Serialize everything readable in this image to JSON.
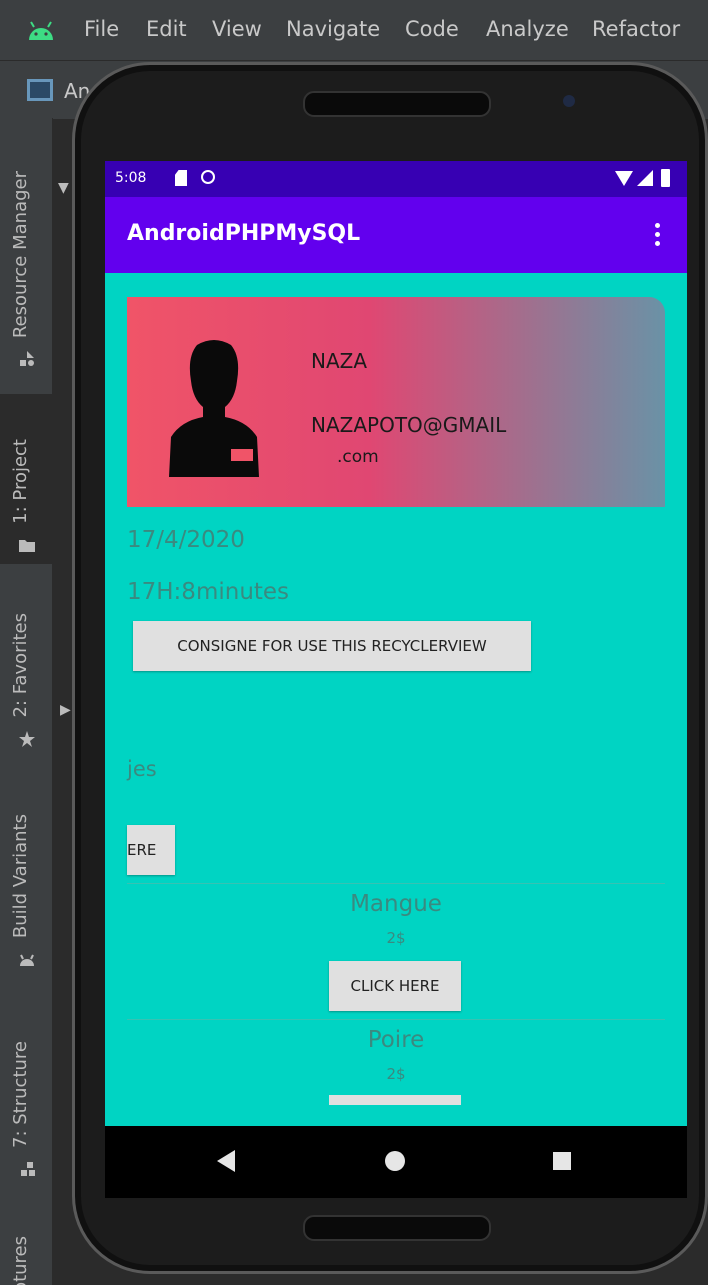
{
  "ide": {
    "menu": [
      "File",
      "Edit",
      "View",
      "Navigate",
      "Code",
      "Analyze",
      "Refactor"
    ],
    "breadcrumb": "And",
    "tool_windows": {
      "resource_manager": "Resource Manager",
      "project": "1: Project",
      "favorites": "2: Favorites",
      "build_variants": "Build Variants",
      "structure": "7: Structure",
      "captures": "ptures"
    }
  },
  "phone": {
    "status_bar": {
      "time": "5:08"
    },
    "app_bar": {
      "title": "AndroidPHPMySQL",
      "overflow_icon": "more-vert-icon"
    },
    "profile": {
      "name": "NAZA",
      "email": "NAZAPOTO@GMAIL",
      "email_suffix": ".com",
      "avatar_icon": "person-icon"
    },
    "date": "17/4/2020",
    "hour": "17H:8minutes",
    "consigne_button": "CONSIGNE FOR USE THIS RECYCLERVIEW",
    "partial_text": "jes",
    "partial_button": "ERE",
    "items": [
      {
        "name": "Mangue",
        "price": "2$",
        "button": "CLICK HERE"
      },
      {
        "name": "Poire",
        "price": "2$"
      }
    ],
    "colors": {
      "status_bar": "#3700b3",
      "app_bar": "#6200ee",
      "background": "#00d4c3"
    }
  }
}
